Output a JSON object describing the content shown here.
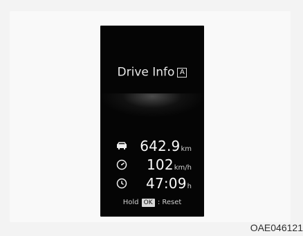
{
  "title": "Drive Info",
  "mode_badge": "A",
  "rows": [
    {
      "icon": "distance-icon",
      "value": "642.9",
      "unit": "km"
    },
    {
      "icon": "speedometer-icon",
      "value": "102",
      "unit": "km/h"
    },
    {
      "icon": "clock-icon",
      "value": "47:09",
      "unit": "h"
    }
  ],
  "hint": {
    "before": "Hold",
    "button": "OK",
    "after": ": Reset"
  },
  "caption": "OAE046121",
  "colors": {
    "screen": "#050505",
    "text": "#f2f2f2",
    "background": "#f3f3f3"
  }
}
